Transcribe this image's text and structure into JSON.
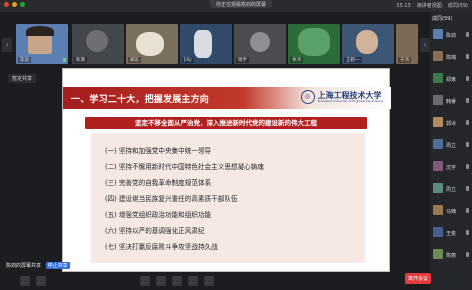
{
  "topbar": {
    "share_notice": "你正在观看陈劲的屏幕",
    "time": "35:13",
    "view_mode": "演讲者视图",
    "participants": "成同(59)"
  },
  "video_strip": {
    "tiles": [
      {
        "name": "陈劲"
      },
      {
        "name": "陈璐"
      },
      {
        "name": "郑东"
      },
      {
        "name": "Jilly"
      },
      {
        "name": "钱宇"
      },
      {
        "name": "余鸿"
      },
      {
        "name": "王鹤一"
      },
      {
        "name": "于鸿"
      }
    ]
  },
  "left_button": {
    "label": "暂定共享"
  },
  "slide": {
    "header_title": "一、学习二十大，把握发展主方向",
    "logo_name": "上海工程技术大学",
    "logo_sub": "Shanghai University of Engineering Science",
    "banner": "坚定不移全面从严治党，深入推进新时代党的建设新的伟大工程",
    "items": [
      "(一) 坚持和加强党中央集中统一领导",
      "(二) 坚持不懈用新时代中国特色社会主义思想凝心铸魂",
      "(三) 完善党的自我革命制度规范体系",
      "(四) 建设堪当民族复兴重任的高素质干部队伍",
      "(五) 增强党组织政治功能和组织功能",
      "(六) 坚持以严的基调强化正风肃纪",
      "(七) 坚决打赢反腐败斗争攻坚战持久战"
    ]
  },
  "sidebar": {
    "title": "成同(59)",
    "rows": [
      {
        "name": "陈劲"
      },
      {
        "name": "陈璐"
      },
      {
        "name": "郑東"
      },
      {
        "name": "韩睿"
      },
      {
        "name": "郭冰"
      },
      {
        "name": "周立"
      },
      {
        "name": "沈宇"
      },
      {
        "name": "周立"
      },
      {
        "name": "马楠"
      },
      {
        "name": "王俊"
      },
      {
        "name": "陈丽"
      }
    ]
  },
  "bottom": {
    "share_status": "陈劲的屏幕共享",
    "share_button": "停止共享",
    "leave": "离开会议",
    "chat": "聊天"
  }
}
